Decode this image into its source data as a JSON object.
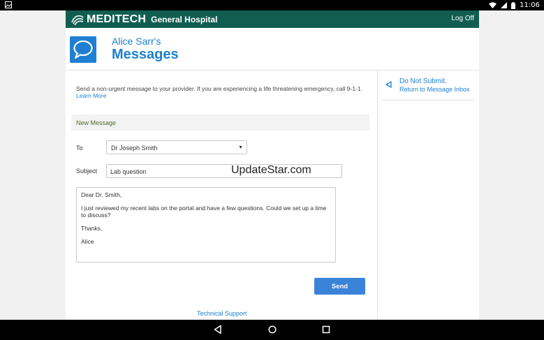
{
  "status_bar": {
    "time": "11:06",
    "icons": [
      "photo-icon",
      "wifi-icon",
      "signal-icon",
      "battery-icon"
    ]
  },
  "app": {
    "brand": "MEDITECH",
    "brand_sub": "General Hospital",
    "logoff_label": "Log Off",
    "brand_color": "#115e51",
    "accent_color": "#1b7fd0"
  },
  "header": {
    "owner": "Alice Sarr's",
    "title": "Messages",
    "tile_icon": "message-bubble-icon"
  },
  "notice": {
    "text": "Send a non-urgent message to your provider. If you are experiencing a life threatening emergency, call 9-1-1.",
    "link": "Learn More"
  },
  "form": {
    "section_title": "New Message",
    "to_label": "To",
    "to_value": "Dr Joseph Smith",
    "subject_label": "Subject",
    "subject_value": "Lab question",
    "body_lines": [
      "Dear Dr. Smith,",
      "I just reviewed my recent labs on the portal and have a few questions. Could we set up a time to discuss?",
      "Thanks,",
      "Alice"
    ],
    "send_label": "Send"
  },
  "watermark": "UpdateStar.com",
  "footer": {
    "support_link": "Technical Support"
  },
  "sidebar": {
    "do_not_submit": "Do Not Submit.",
    "return_link": "Return to Message Inbox"
  },
  "nav_bar": {
    "icons": [
      "back-icon",
      "home-icon",
      "recents-icon"
    ]
  }
}
